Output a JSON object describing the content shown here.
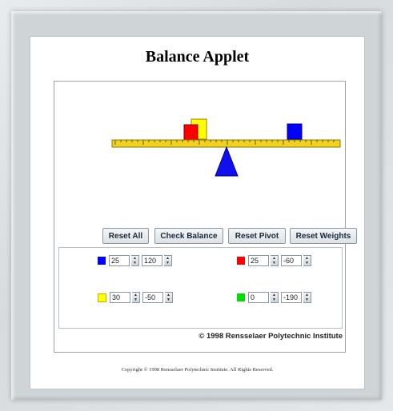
{
  "page": {
    "title": "Balance Applet",
    "copyright_footer": "Copyright © 1998 Rensselaer Polytechnic Institute. All Rights Reserved."
  },
  "applet": {
    "buttons": {
      "reset_all": "Reset All",
      "check_balance": "Check Balance",
      "reset_pivot": "Reset Pivot",
      "reset_weights": "Reset Weights"
    },
    "weights": [
      {
        "color": "#0000ff",
        "mass": "25",
        "position": "120"
      },
      {
        "color": "#ff0000",
        "mass": "25",
        "position": "-60"
      },
      {
        "color": "#ffff00",
        "mass": "30",
        "position": "-50"
      },
      {
        "color": "#00dd00",
        "mass": "0",
        "position": "-190"
      }
    ],
    "copyright": "© 1998 Rensselaer Polytechnic Institute"
  },
  "colors": {
    "beam": "#f2d21e",
    "pivot": "#1010ee",
    "accent": "#0000ff"
  }
}
